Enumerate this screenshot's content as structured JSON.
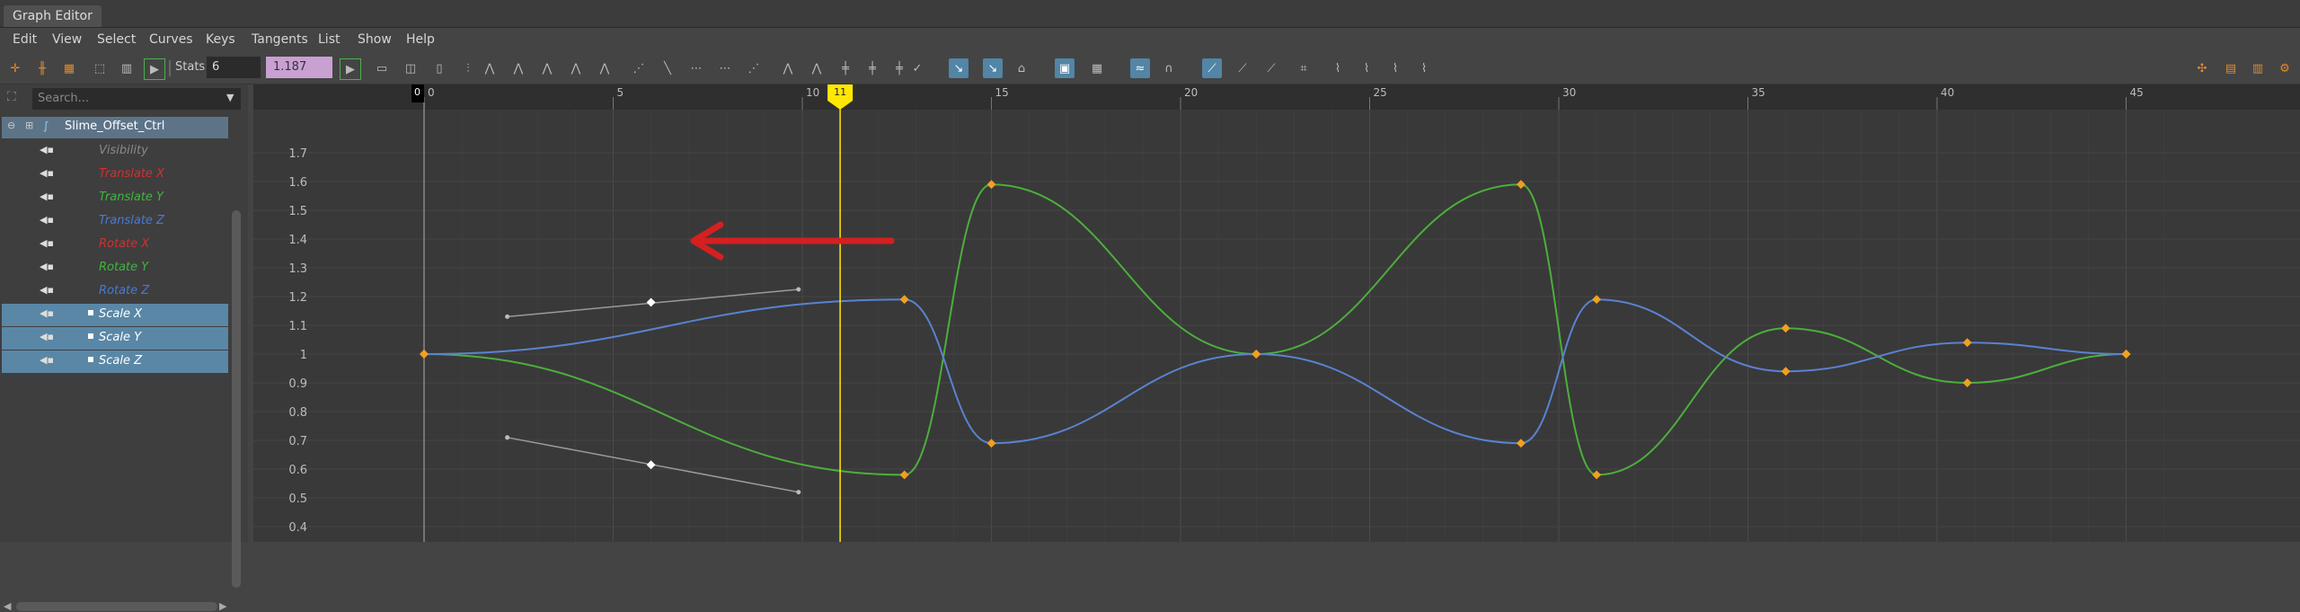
{
  "window": {
    "title": "Graph Editor"
  },
  "menu": [
    "Edit",
    "View",
    "Select",
    "Curves",
    "Keys",
    "Tangents",
    "List",
    "Show",
    "Help"
  ],
  "toolbar": {
    "stats_label": "Stats",
    "stats_value": "6",
    "value_field": "1.187"
  },
  "outliner": {
    "search_placeholder": "Search...",
    "node": "Slime_Offset_Ctrl",
    "attributes": [
      {
        "label": "Visibility",
        "color": "#8a8a8a",
        "selected": false
      },
      {
        "label": "Translate X",
        "color": "#d23030",
        "selected": false
      },
      {
        "label": "Translate Y",
        "color": "#3fb53f",
        "selected": false
      },
      {
        "label": "Translate Z",
        "color": "#4a78d6",
        "selected": false
      },
      {
        "label": "Rotate X",
        "color": "#d23030",
        "selected": false
      },
      {
        "label": "Rotate Y",
        "color": "#3fb53f",
        "selected": false
      },
      {
        "label": "Rotate Z",
        "color": "#4a78d6",
        "selected": false
      },
      {
        "label": "Scale X",
        "color": "#ffffff",
        "selected": true
      },
      {
        "label": "Scale Y",
        "color": "#ffffff",
        "selected": true
      },
      {
        "label": "Scale Z",
        "color": "#ffffff",
        "selected": true
      }
    ]
  },
  "graph": {
    "current_frame": "11",
    "start_frame_label": "0",
    "frame_ticks": [
      "0",
      "5",
      "10",
      "15",
      "20",
      "25",
      "30",
      "35",
      "40",
      "45"
    ],
    "value_ticks": [
      "1.7",
      "1.6",
      "1.5",
      "1.4",
      "1.3",
      "1.2",
      "1.1",
      "1",
      "0.9",
      "0.8",
      "0.7",
      "0.6",
      "0.5",
      "0.4"
    ],
    "colors": {
      "green_curve": "#4cae3c",
      "blue_curve": "#5a82d0",
      "key": "#f0a020",
      "current_time": "#ffe800",
      "arrow": "#d42020"
    }
  }
}
